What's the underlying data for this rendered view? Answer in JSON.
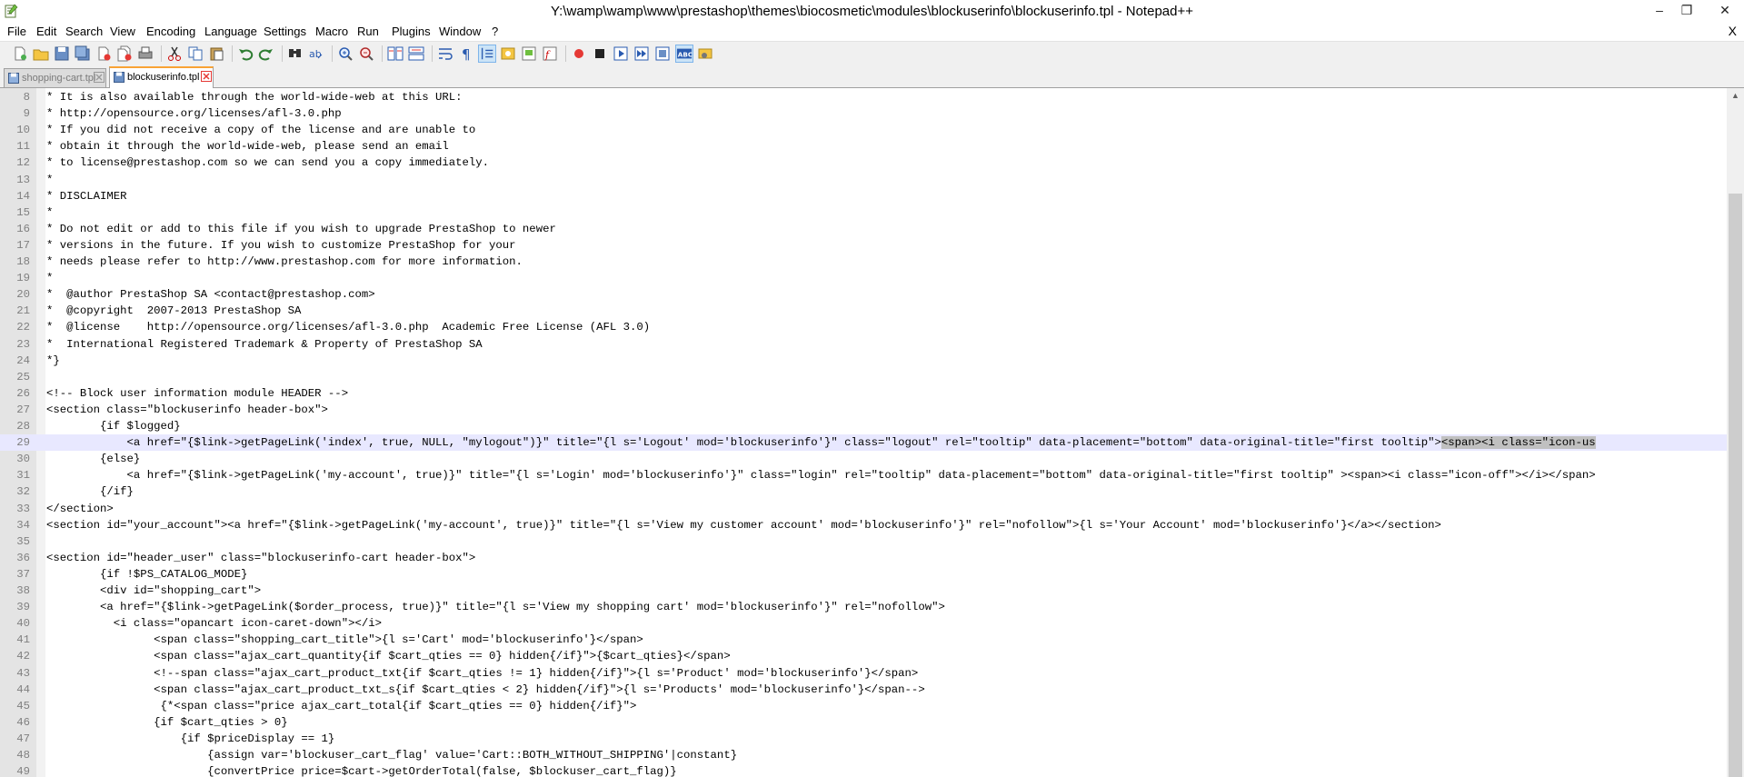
{
  "window": {
    "title": "Y:\\wamp\\wamp\\www\\prestashop\\themes\\biocosmetic\\modules\\blockuserinfo\\blockuserinfo.tpl - Notepad++",
    "controls": {
      "minimize": "–",
      "restore": "❐",
      "close": "✕"
    }
  },
  "menu": {
    "items": [
      "File",
      "Edit",
      "Search",
      "View",
      "Encoding",
      "Language",
      "Settings",
      "Macro",
      "Run",
      "Plugins",
      "Window",
      "?"
    ],
    "close_label": "X"
  },
  "toolbar": {
    "buttons": [
      "new-file-icon",
      "open-file-icon",
      "save-icon",
      "save-all-icon",
      "close-icon",
      "close-all-icon",
      "print-icon",
      "cut-icon",
      "copy-icon",
      "paste-icon",
      "undo-icon",
      "redo-icon",
      "find-icon",
      "replace-icon",
      "zoom-in-icon",
      "zoom-out-icon",
      "sync-vertical-icon",
      "sync-horizontal-icon",
      "word-wrap-icon",
      "show-all-chars-icon",
      "indent-guide-icon",
      "user-lang-icon",
      "doc-map-icon",
      "function-list-icon",
      "record-macro-icon",
      "stop-record-icon",
      "play-macro-icon",
      "run-macro-multiple-icon",
      "save-macro-icon",
      "spell-check-icon",
      "plugin-icon"
    ]
  },
  "tabs": [
    {
      "label": "shopping-cart.tpl",
      "active": false
    },
    {
      "label": "blockuserinfo.tpl",
      "active": true
    }
  ],
  "editor": {
    "current_line": 29,
    "lines": [
      {
        "n": "8",
        "text": "* It is also available through the world-wide-web at this URL:"
      },
      {
        "n": "9",
        "text": "* http://opensource.org/licenses/afl-3.0.php"
      },
      {
        "n": "10",
        "text": "* If you did not receive a copy of the license and are unable to"
      },
      {
        "n": "11",
        "text": "* obtain it through the world-wide-web, please send an email"
      },
      {
        "n": "12",
        "text": "* to license@prestashop.com so we can send you a copy immediately."
      },
      {
        "n": "13",
        "text": "*"
      },
      {
        "n": "14",
        "text": "* DISCLAIMER"
      },
      {
        "n": "15",
        "text": "*"
      },
      {
        "n": "16",
        "text": "* Do not edit or add to this file if you wish to upgrade PrestaShop to newer"
      },
      {
        "n": "17",
        "text": "* versions in the future. If you wish to customize PrestaShop for your"
      },
      {
        "n": "18",
        "text": "* needs please refer to http://www.prestashop.com for more information."
      },
      {
        "n": "19",
        "text": "*"
      },
      {
        "n": "20",
        "text": "*  @author PrestaShop SA <contact@prestashop.com>"
      },
      {
        "n": "21",
        "text": "*  @copyright  2007-2013 PrestaShop SA"
      },
      {
        "n": "22",
        "text": "*  @license    http://opensource.org/licenses/afl-3.0.php  Academic Free License (AFL 3.0)"
      },
      {
        "n": "23",
        "text": "*  International Registered Trademark & Property of PrestaShop SA"
      },
      {
        "n": "24",
        "text": "*}"
      },
      {
        "n": "25",
        "text": ""
      },
      {
        "n": "26",
        "text": "<!-- Block user information module HEADER -->"
      },
      {
        "n": "27",
        "text": "<section class=\"blockuserinfo header-box\">"
      },
      {
        "n": "28",
        "text": "        {if $logged}"
      },
      {
        "n": "29",
        "text": "            <a href=\"{$link->getPageLink('index', true, NULL, \"mylogout\")}\" title=\"{l s='Logout' mod='blockuserinfo'}\" class=\"logout\" rel=\"tooltip\" data-placement=\"bottom\" data-original-title=\"first tooltip\">",
        "selected": "<span><i class=\"icon-us"
      },
      {
        "n": "30",
        "text": "        {else}"
      },
      {
        "n": "31",
        "text": "            <a href=\"{$link->getPageLink('my-account', true)}\" title=\"{l s='Login' mod='blockuserinfo'}\" class=\"login\" rel=\"tooltip\" data-placement=\"bottom\" data-original-title=\"first tooltip\" ><span><i class=\"icon-off\"></i></span>"
      },
      {
        "n": "32",
        "text": "        {/if}"
      },
      {
        "n": "33",
        "text": "</section>"
      },
      {
        "n": "34",
        "text": "<section id=\"your_account\"><a href=\"{$link->getPageLink('my-account', true)}\" title=\"{l s='View my customer account' mod='blockuserinfo'}\" rel=\"nofollow\">{l s='Your Account' mod='blockuserinfo'}</a></section>"
      },
      {
        "n": "35",
        "text": ""
      },
      {
        "n": "36",
        "text": "<section id=\"header_user\" class=\"blockuserinfo-cart header-box\">"
      },
      {
        "n": "37",
        "text": "        {if !$PS_CATALOG_MODE}"
      },
      {
        "n": "38",
        "text": "        <div id=\"shopping_cart\">"
      },
      {
        "n": "39",
        "text": "        <a href=\"{$link->getPageLink($order_process, true)}\" title=\"{l s='View my shopping cart' mod='blockuserinfo'}\" rel=\"nofollow\">"
      },
      {
        "n": "40",
        "text": "          <i class=\"opancart icon-caret-down\"></i>"
      },
      {
        "n": "41",
        "text": "                <span class=\"shopping_cart_title\">{l s='Cart' mod='blockuserinfo'}</span>"
      },
      {
        "n": "42",
        "text": "                <span class=\"ajax_cart_quantity{if $cart_qties == 0} hidden{/if}\">{$cart_qties}</span>"
      },
      {
        "n": "43",
        "text": "                <!--span class=\"ajax_cart_product_txt{if $cart_qties != 1} hidden{/if}\">{l s='Product' mod='blockuserinfo'}</span>"
      },
      {
        "n": "44",
        "text": "                <span class=\"ajax_cart_product_txt_s{if $cart_qties < 2} hidden{/if}\">{l s='Products' mod='blockuserinfo'}</span-->"
      },
      {
        "n": "45",
        "text": "                 {*<span class=\"price ajax_cart_total{if $cart_qties == 0} hidden{/if}\">"
      },
      {
        "n": "46",
        "text": "                {if $cart_qties > 0}"
      },
      {
        "n": "47",
        "text": "                    {if $priceDisplay == 1}"
      },
      {
        "n": "48",
        "text": "                        {assign var='blockuser_cart_flag' value='Cart::BOTH_WITHOUT_SHIPPING'|constant}"
      },
      {
        "n": "49",
        "text": "                        {convertPrice price=$cart->getOrderTotal(false, $blockuser_cart_flag)}"
      }
    ]
  }
}
